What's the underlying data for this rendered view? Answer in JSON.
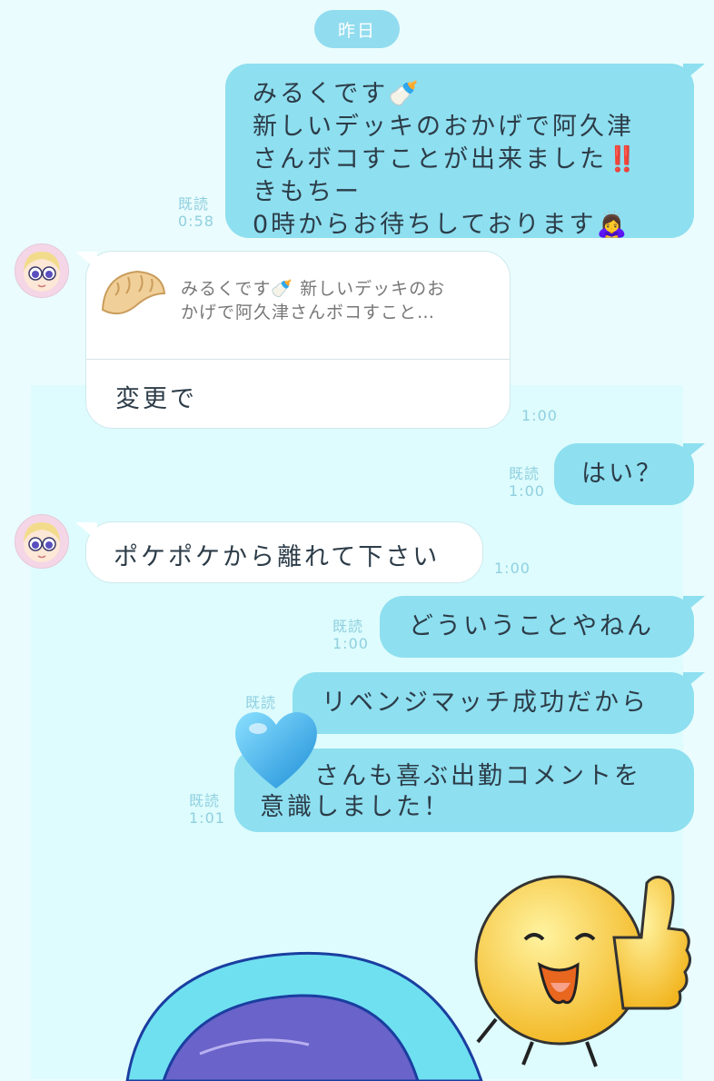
{
  "date_divider": "昨日",
  "messages": [
    {
      "side": "me",
      "lines": [
        "みるくです🍼",
        "新しいデッキのおかげで阿久津",
        "さんボコすことが出来ました‼️",
        "きもちー",
        "0時からお待ちしております🙇‍♀️"
      ],
      "read": "既読",
      "time": "0:58"
    },
    {
      "side": "them",
      "quote": "みるくです🍼 新しいデッキのおかげで阿久津さんボコすこと…",
      "quote_l1": "みるくです🍼 新しいデッキのお",
      "quote_l2": "かげで阿久津さんボコすこと…",
      "text": "変更で",
      "time": "1:00"
    },
    {
      "side": "me",
      "text": "はい？",
      "read": "既読",
      "time": "1:00"
    },
    {
      "side": "them",
      "text": "ポケポケから離れて下さい",
      "time": "1:00"
    },
    {
      "side": "me",
      "text": "どういうことやねん",
      "read": "既読",
      "time": "1:00"
    },
    {
      "side": "me",
      "text": "リベンジマッチ成功だから",
      "read": "既読",
      "time": ""
    },
    {
      "side": "me",
      "lines": [
        "さんも喜ぶ出勤コメントを",
        "意識しました！"
      ],
      "read": "既読",
      "time": "1:01"
    }
  ],
  "colors": {
    "my_bubble": "#8edff0",
    "their_bubble": "#ffffff",
    "background": "#eafcfd",
    "meta_text": "#8fcfe0"
  },
  "icons": [
    "baby-bottle-emoji",
    "dumpling-icon",
    "double-exclamation-emoji",
    "bowing-woman-emoji",
    "blue-heart-sticker",
    "thumbs-up-character-sticker",
    "avatar-icon"
  ]
}
